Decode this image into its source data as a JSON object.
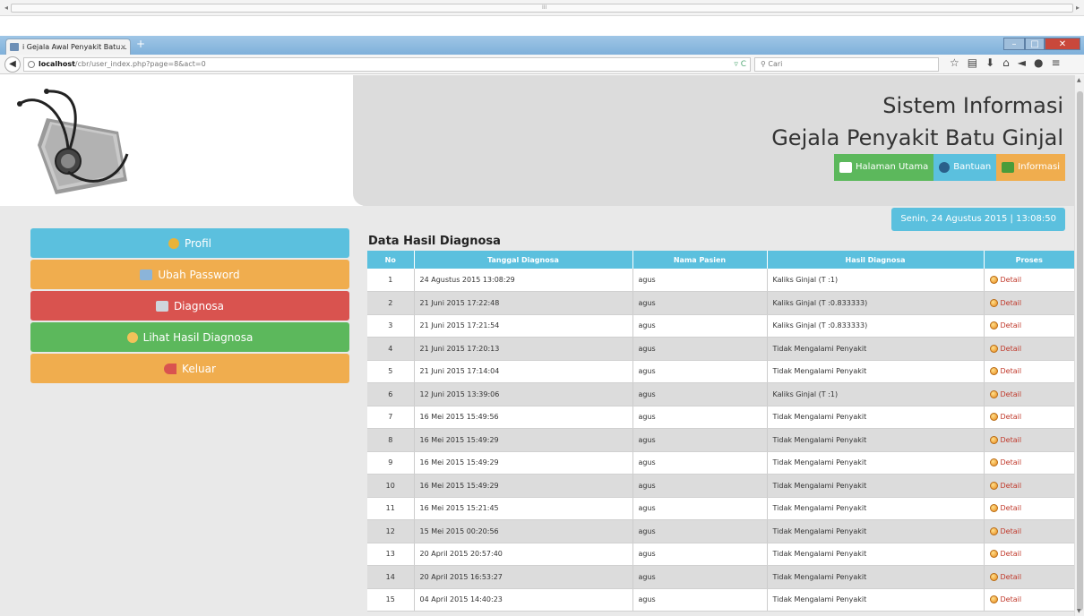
{
  "browser": {
    "tab_title": "i Gejala Awal Penyakit Batu...",
    "tab_close": "×",
    "new_tab": "+",
    "url_host": "localhost",
    "url_path": "/cbr/user_index.php?page=8&act=0",
    "search_placeholder": "Cari",
    "outer_scroll_grip": "III"
  },
  "header": {
    "title_line1": "Sistem Informasi",
    "title_line2": "Gejala Penyakit Batu Ginjal",
    "nav": [
      {
        "label": "Halaman Utama"
      },
      {
        "label": "Bantuan"
      },
      {
        "label": "Informasi"
      }
    ]
  },
  "datebar": {
    "text": "Senin, 24 Agustus 2015   |   13:08:50"
  },
  "sidebar": {
    "items": [
      {
        "label": "Profil"
      },
      {
        "label": "Ubah Password"
      },
      {
        "label": "Diagnosa"
      },
      {
        "label": "Lihat Hasil Diagnosa"
      },
      {
        "label": "Keluar"
      }
    ]
  },
  "main": {
    "section_title": "Data Hasil Diagnosa",
    "columns": [
      "No",
      "Tanggal Diagnosa",
      "Nama Pasien",
      "Hasil Diagnosa",
      "Proses"
    ],
    "detail_label": "Detail",
    "rows": [
      {
        "no": "1",
        "tanggal": "24 Agustus 2015 13:08:29",
        "nama": "agus",
        "hasil": "Kaliks Ginjal (T :1)"
      },
      {
        "no": "2",
        "tanggal": "21 Juni 2015 17:22:48",
        "nama": "agus",
        "hasil": "Kaliks Ginjal (T :0.833333)"
      },
      {
        "no": "3",
        "tanggal": "21 Juni 2015 17:21:54",
        "nama": "agus",
        "hasil": "Kaliks Ginjal (T :0.833333)"
      },
      {
        "no": "4",
        "tanggal": "21 Juni 2015 17:20:13",
        "nama": "agus",
        "hasil": "Tidak Mengalami Penyakit"
      },
      {
        "no": "5",
        "tanggal": "21 Juni 2015 17:14:04",
        "nama": "agus",
        "hasil": "Tidak Mengalami Penyakit"
      },
      {
        "no": "6",
        "tanggal": "12 Juni 2015 13:39:06",
        "nama": "agus",
        "hasil": "Kaliks Ginjal (T :1)"
      },
      {
        "no": "7",
        "tanggal": "16 Mei 2015 15:49:56",
        "nama": "agus",
        "hasil": "Tidak Mengalami Penyakit"
      },
      {
        "no": "8",
        "tanggal": "16 Mei 2015 15:49:29",
        "nama": "agus",
        "hasil": "Tidak Mengalami Penyakit"
      },
      {
        "no": "9",
        "tanggal": "16 Mei 2015 15:49:29",
        "nama": "agus",
        "hasil": "Tidak Mengalami Penyakit"
      },
      {
        "no": "10",
        "tanggal": "16 Mei 2015 15:49:29",
        "nama": "agus",
        "hasil": "Tidak Mengalami Penyakit"
      },
      {
        "no": "11",
        "tanggal": "16 Mei 2015 15:21:45",
        "nama": "agus",
        "hasil": "Tidak Mengalami Penyakit"
      },
      {
        "no": "12",
        "tanggal": "15 Mei 2015 00:20:56",
        "nama": "agus",
        "hasil": "Tidak Mengalami Penyakit"
      },
      {
        "no": "13",
        "tanggal": "20 April 2015 20:57:40",
        "nama": "agus",
        "hasil": "Tidak Mengalami Penyakit"
      },
      {
        "no": "14",
        "tanggal": "20 April 2015 16:53:27",
        "nama": "agus",
        "hasil": "Tidak Mengalami Penyakit"
      },
      {
        "no": "15",
        "tanggal": "04 April 2015 14:40:23",
        "nama": "agus",
        "hasil": "Tidak Mengalami Penyakit"
      }
    ]
  },
  "colors": {
    "info": "#5bc0de",
    "warning": "#f0ad4e",
    "danger": "#d9534f",
    "success": "#5cb85c"
  }
}
